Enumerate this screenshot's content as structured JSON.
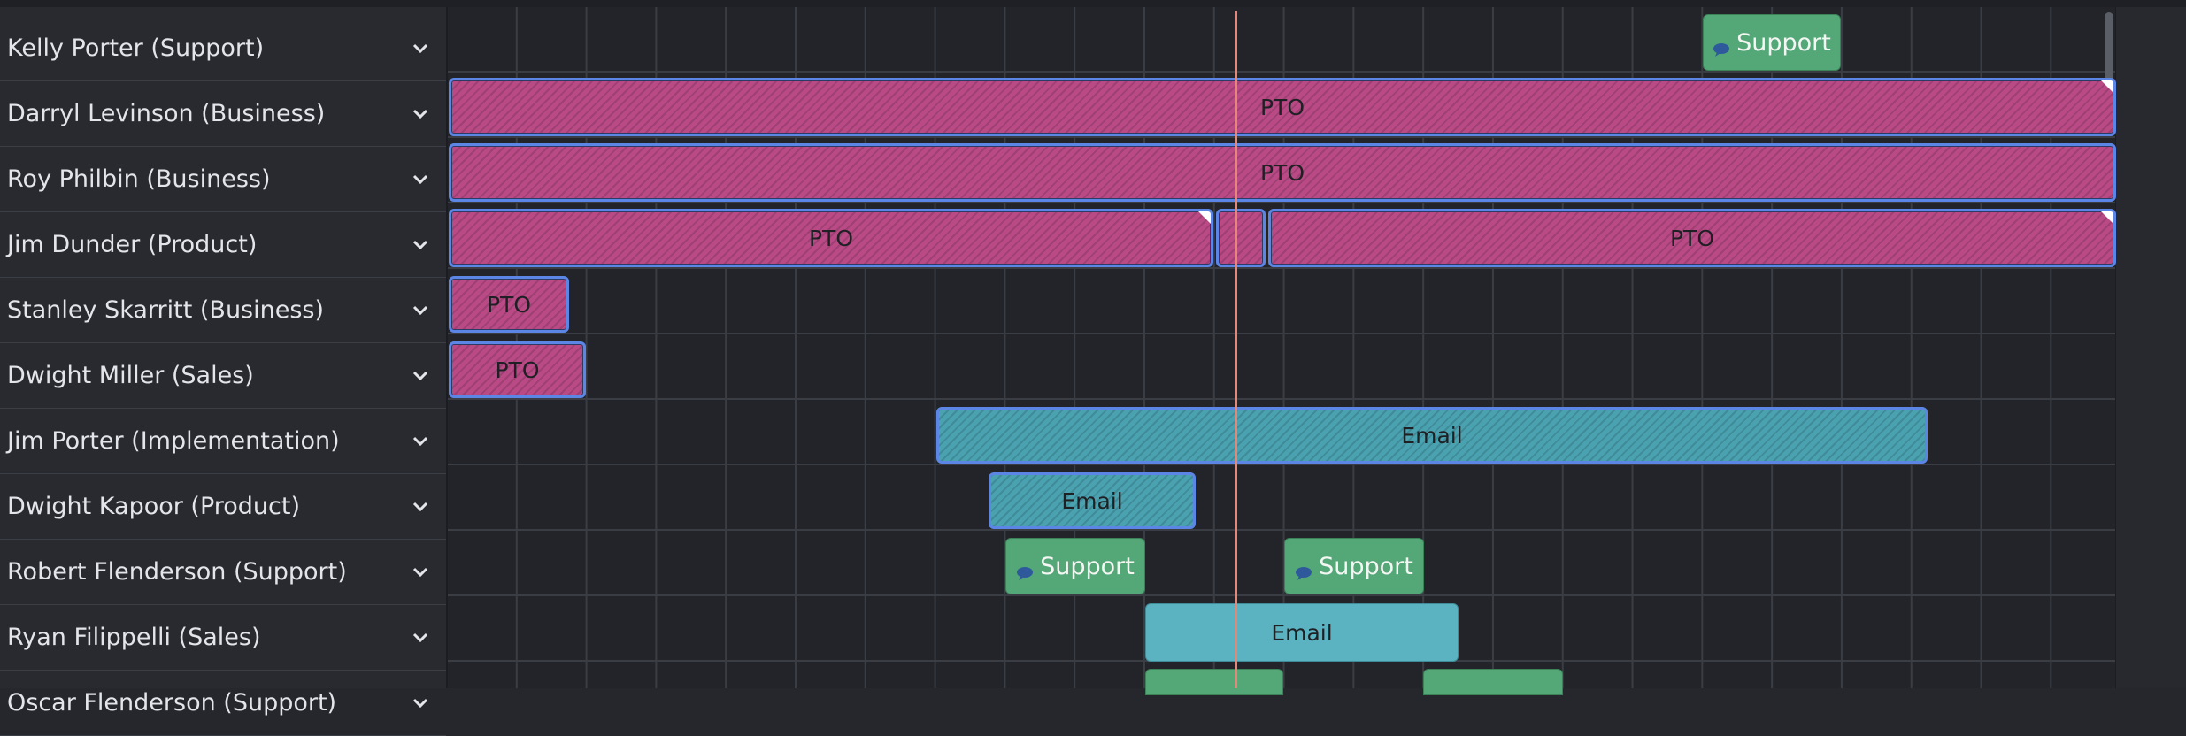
{
  "colors": {
    "pto": "#b94a86",
    "email": "#5bb3c2",
    "support": "#54a878",
    "selection_border": "#5b86e6",
    "current_time": "#e88775"
  },
  "icons": {
    "row_expand": "chevron-down-icon",
    "support": "chat-bubble-icon"
  },
  "rows": [
    {
      "label": "Kelly Porter (Support)"
    },
    {
      "label": "Darryl Levinson (Business)"
    },
    {
      "label": "Roy Philbin (Business)"
    },
    {
      "label": "Jim Dunder (Product)"
    },
    {
      "label": "Stanley Skarritt (Business)"
    },
    {
      "label": "Dwight Miller (Sales)"
    },
    {
      "label": "Jim Porter (Implementation)"
    },
    {
      "label": "Dwight Kapoor (Product)"
    },
    {
      "label": "Robert Flenderson (Support)"
    },
    {
      "label": "Ryan Filippelli (Sales)"
    },
    {
      "label": "Oscar Flenderson (Support)"
    }
  ],
  "events": {
    "kelly_support": "Support",
    "darryl_pto": "PTO",
    "roy_pto": "PTO",
    "jim_dunder_pto_1": "PTO",
    "jim_dunder_pto_2": "PTO",
    "stanley_pto": "PTO",
    "dwight_miller_pto": "PTO",
    "jim_porter_email": "Email",
    "dwight_kapoor_email": "Email",
    "robert_support_1": "Support",
    "robert_support_2": "Support",
    "ryan_email": "Email"
  }
}
